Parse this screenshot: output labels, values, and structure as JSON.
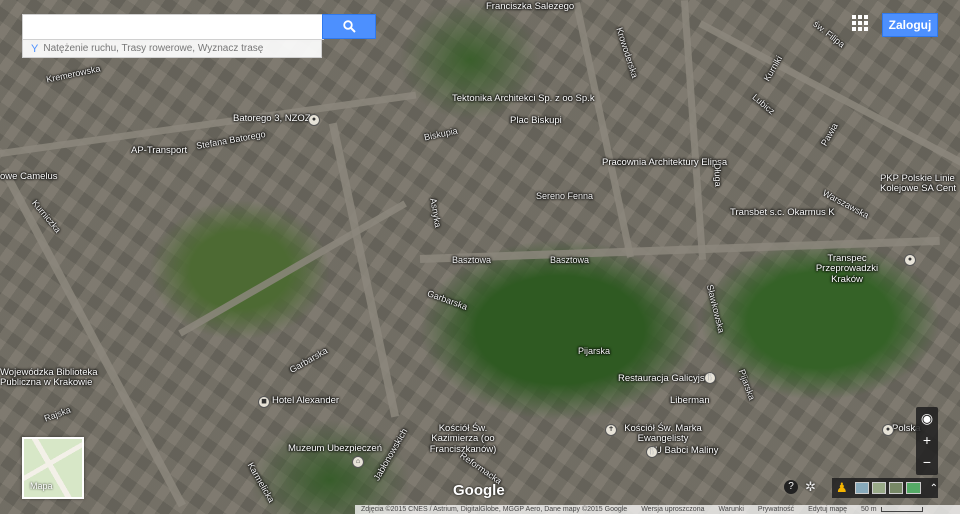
{
  "search": {
    "value": "",
    "placeholder": "",
    "button_icon": "search-icon",
    "hint": "Natężenie ruchu, Trasy rowerowe, Wyznacz trasę",
    "hint_icon": "route-icon"
  },
  "header": {
    "login_label": "Zaloguj",
    "apps_icon": "apps-grid-icon"
  },
  "minimap": {
    "label": "Mapa"
  },
  "zoom": {
    "compass": "◉",
    "in": "+",
    "out": "−"
  },
  "controls": {
    "pegman_icon": "pegman-icon",
    "help": "?",
    "expand": "⌃"
  },
  "google_logo": "Google",
  "footer": {
    "attribution": "Zdjęcia ©2015 CNES / Astrium, DigitalGlobe, MGGP Aero, Dane mapy ©2015 Google",
    "report": "Wersja uproszczona",
    "terms": "Warunki",
    "privacy": "Prywatność",
    "feedback": "Edytuj mapę",
    "scale": "50 m"
  },
  "map": {
    "labels": [
      "Franciszka Salezego",
      "Krowoderska",
      "Kremerowska",
      "Tektonika Architekci Sp. z oo Sp.k",
      "Plac Biskupi",
      "Batorego 3, NZOZ",
      "AP-Transport",
      "Stefana Batorego",
      "Biskupia",
      "Pracownia Architektury Elipsa",
      "Sereno Fenna",
      "Długa",
      "Kurniczka",
      "owe Camelus",
      "Karmelicka",
      "Asnyka",
      "Basztowa",
      "Basztowa",
      "Garbarska",
      "Garbarska",
      "Sławkowska",
      "Pijarska",
      "Restauracja Galicyjska",
      "Liberman",
      "Kościół Św. Marka Ewangelisty",
      "U Babci Maliny",
      "Kościół Św. Kazimierza (oo Franciszkanów)",
      "Muzeum Ubezpieczeń",
      "Hotel Alexander",
      "Wojewódzka Biblioteka Publiczna w Krakowie",
      "Rajska",
      "Reformacka",
      "Jabłonowskich",
      "Transbet s.c. Okarmus K",
      "Transpec Przeprowadzki Kraków",
      "PKP Polskie Linie Kolejowe SA Cent",
      "Pawia",
      "Lubicz",
      "Warszawska",
      "św. Filipa",
      "Kurniki",
      "Polska",
      "Pijarska"
    ]
  }
}
